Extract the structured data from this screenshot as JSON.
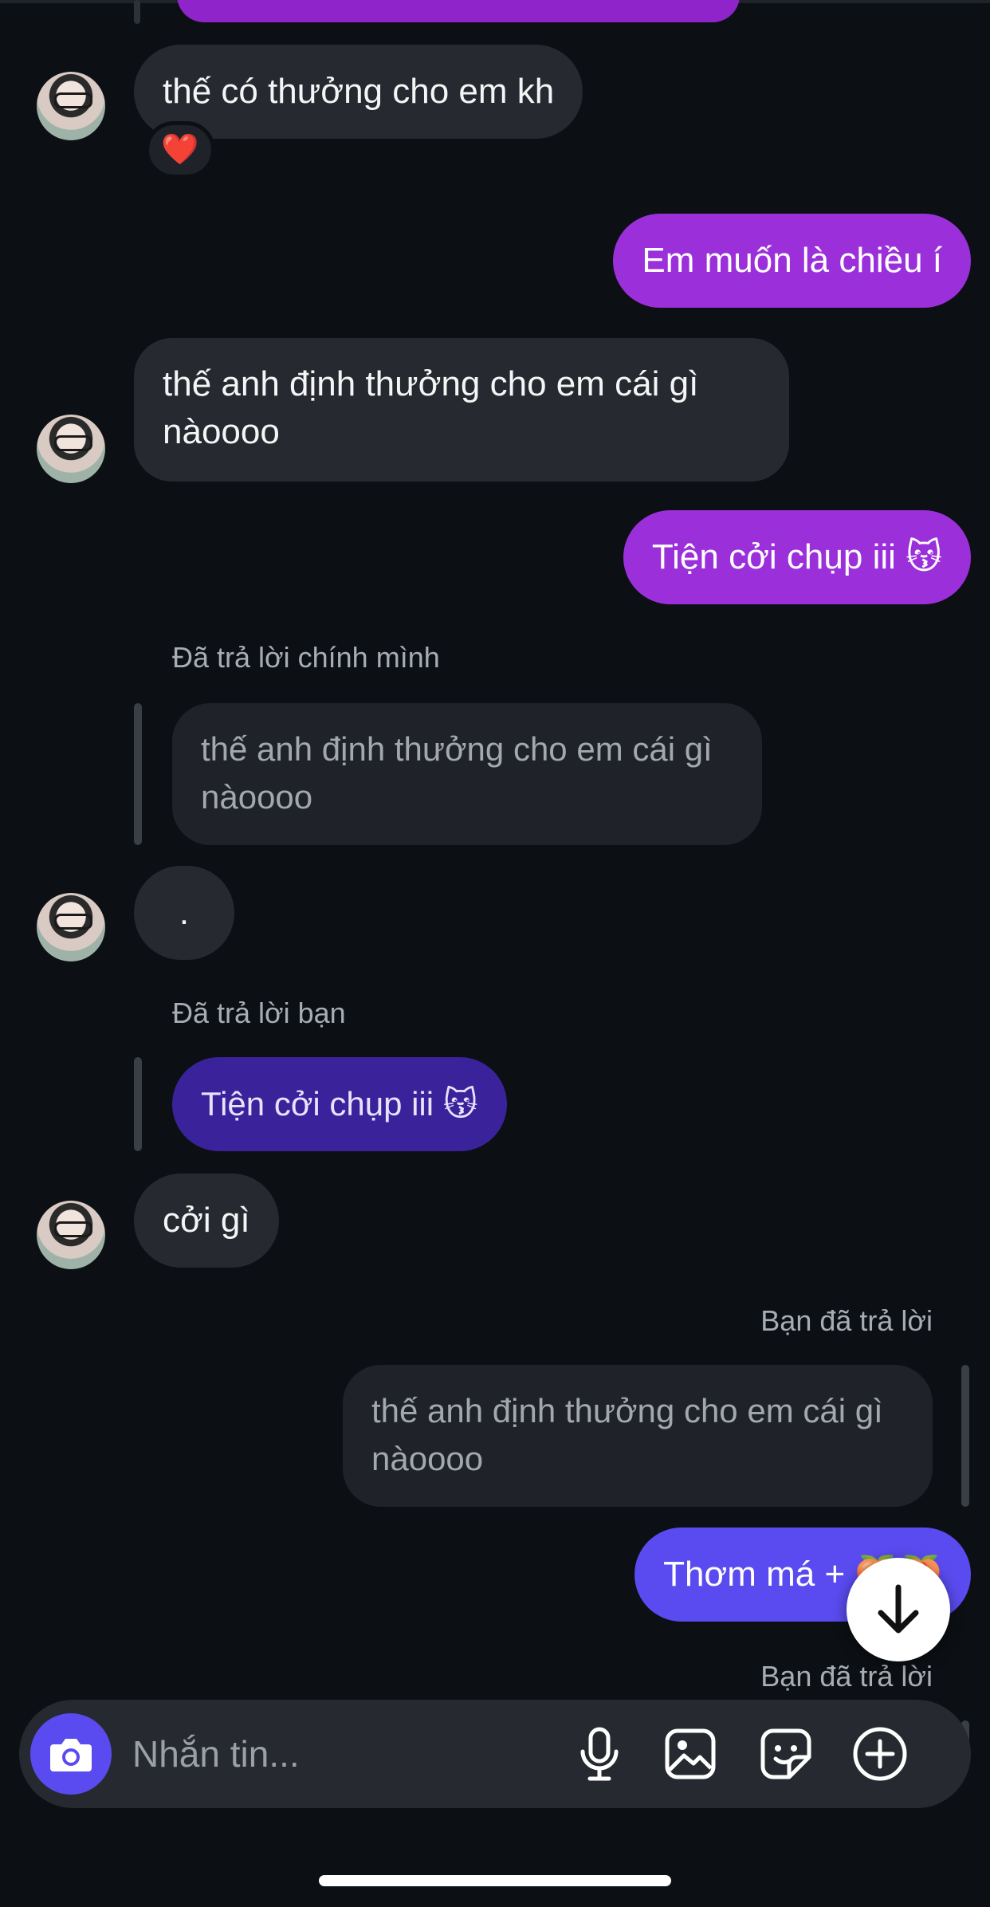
{
  "conversation": {
    "m1": {
      "text": "thế có thưởng cho em kh",
      "reaction": "❤️"
    },
    "m2": {
      "text": "Em muốn là chiều í"
    },
    "m3": {
      "text": "thế anh định thưởng cho em cái gì nàoooo"
    },
    "m4": {
      "text": "Tiện cởi chụp iii 😽"
    },
    "r1": {
      "caption": "Đã trả lời chính mình",
      "quoted": "thế anh định thưởng cho em cái gì nàoooo"
    },
    "m5": {
      "text": "."
    },
    "r2": {
      "caption": "Đã trả lời bạn",
      "quoted": "Tiện cởi chụp iii 😽"
    },
    "m6": {
      "text": "cởi gì"
    },
    "r3": {
      "caption": "Bạn đã trả lời",
      "quoted": "thế anh định thưởng cho em cái gì nàoooo"
    },
    "m7": {
      "text": "Thơm má + 🍑🍑"
    },
    "r4": {
      "caption": "Bạn đã trả lời"
    }
  },
  "composer": {
    "placeholder": "Nhắn tin..."
  },
  "icons": {
    "camera": "camera-icon",
    "mic": "microphone-icon",
    "gallery": "gallery-icon",
    "sticker": "sticker-icon",
    "plus": "plus-icon",
    "scroll": "arrow-down-icon"
  },
  "colors": {
    "background": "#0c1014",
    "incoming": "#262a30",
    "outgoing_purple": "#9b30db",
    "outgoing_violet": "#5a4bf0",
    "accent": "#5a4bf0"
  }
}
